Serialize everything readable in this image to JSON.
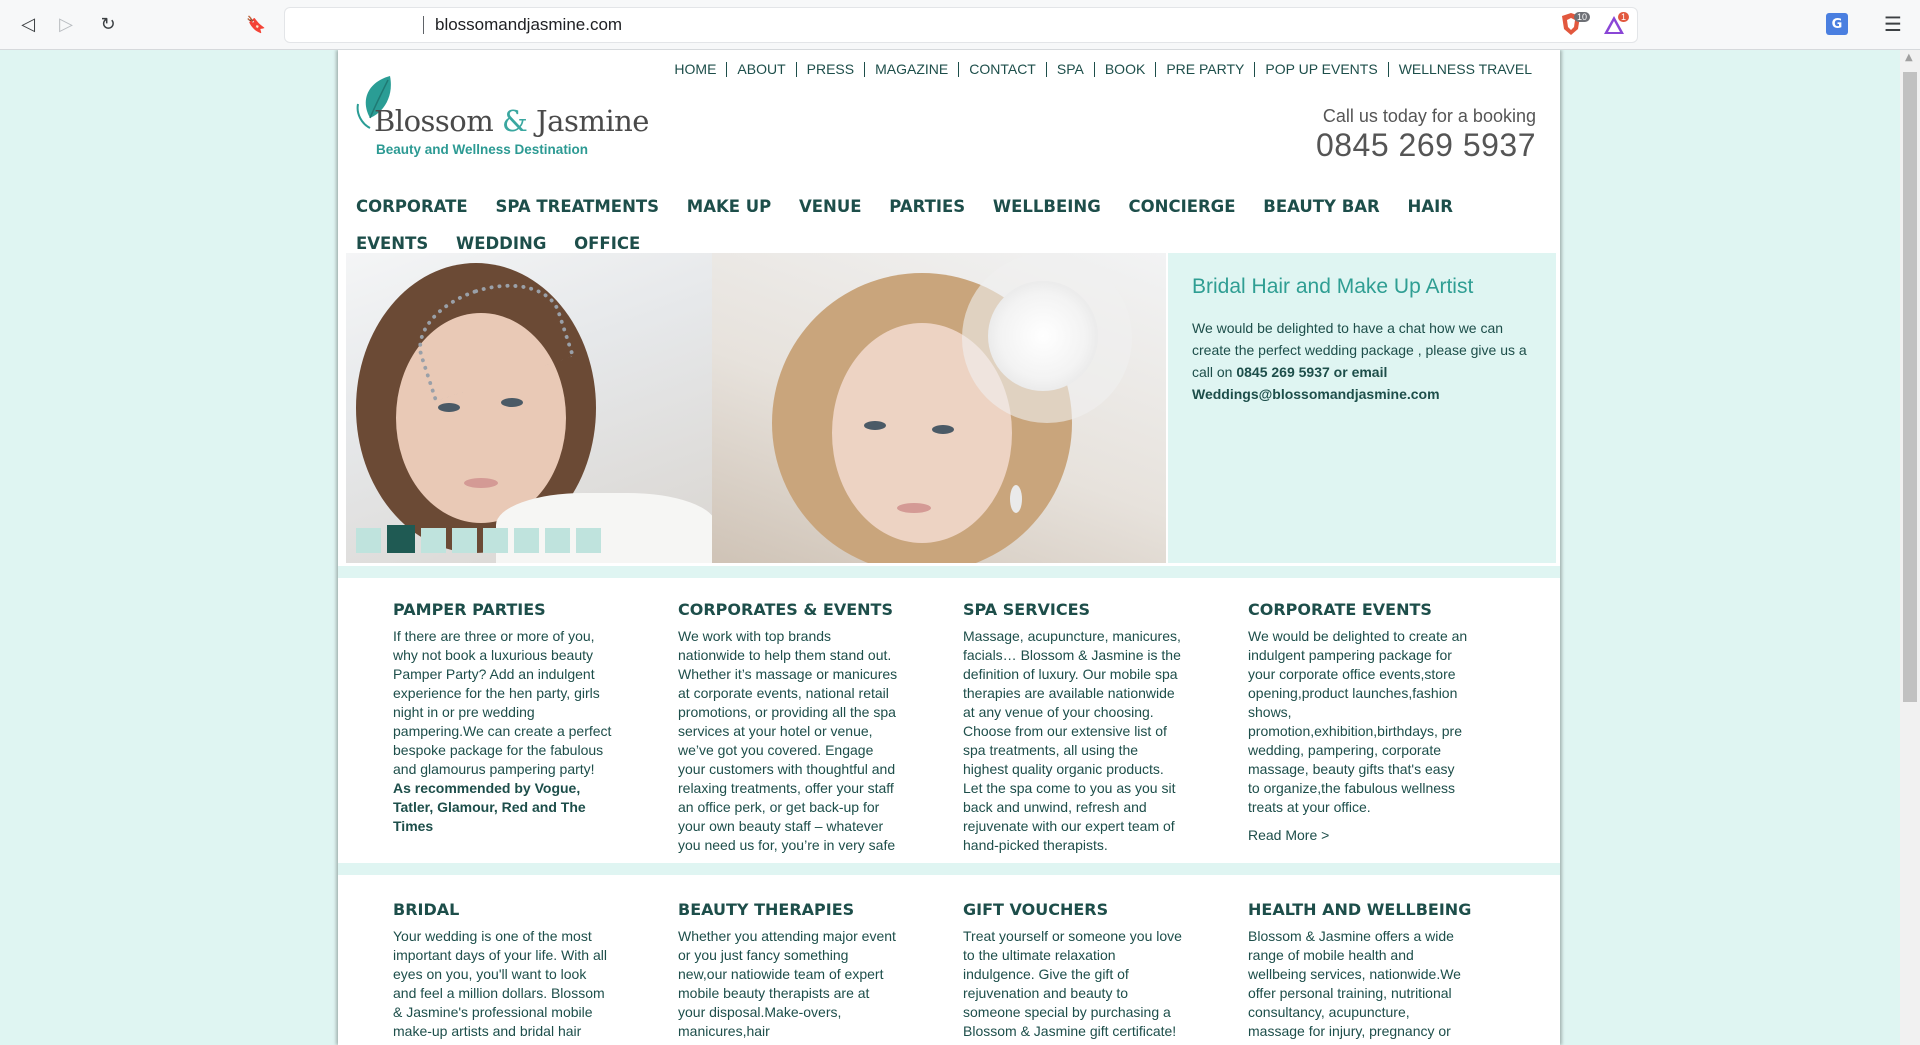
{
  "browser": {
    "url": "blossomandjasmine.com",
    "back_icon": "back-arrow-icon",
    "forward_icon": "forward-arrow-icon",
    "reload_icon": "reload-icon",
    "bookmark_icon": "bookmark-icon",
    "shield_badge": "10",
    "rewards_badge": "1",
    "back_glyph": "◁",
    "forward_glyph": "▷",
    "reload_glyph": "↻",
    "bookmark_glyph": "🔖",
    "menu_glyph": "☰",
    "translate_glyph": "G"
  },
  "topnav": [
    "HOME",
    "ABOUT",
    "PRESS",
    "MAGAZINE",
    "CONTACT",
    "SPA",
    "BOOK",
    "PRE PARTY",
    "POP UP EVENTS",
    "WELLNESS TRAVEL"
  ],
  "logo": {
    "title_left": "Blossom",
    "title_amp": "&",
    "title_right": "Jasmine",
    "subtitle": "Beauty and Wellness Destination"
  },
  "callus": {
    "line1": "Call us today for a booking",
    "phone": "0845 269 5937"
  },
  "mainnav": [
    "CORPORATE",
    "SPA TREATMENTS",
    "MAKE UP",
    "VENUE",
    "PARTIES",
    "WELLBEING",
    "CONCIERGE",
    "BEAUTY BAR",
    "HAIR",
    "EVENTS",
    "WEDDING",
    "OFFICE"
  ],
  "slider": {
    "slide_count": 8,
    "active_index": 1,
    "caption_title": "Bridal Hair and Make Up Artist",
    "caption_text": "We would be delighted to have a chat how we can create the perfect wedding package , please give us a call on ",
    "caption_bold": "0845 269 5937 or email Weddings@blossomandjasmine.com"
  },
  "sections_row1": [
    {
      "title": "PAMPER PARTIES",
      "text": "If there are three or more of you, why not book a luxurious beauty Pamper Party? Add an indulgent experience for the hen party, girls night in or pre wedding pampering.We can create a perfect bespoke package for the fabulous and glamourus pampering party! ",
      "bold": "As recommended by Vogue, Tatler, Glamour, Red and The Times",
      "more": ""
    },
    {
      "title": "CORPORATES & EVENTS",
      "text": "We work with top brands nationwide to help them stand out. Whether it’s massage or manicures at corporate events, national retail promotions, or providing all the spa services at your hotel or venue, we’ve got you covered. Engage your customers with thoughtful and relaxing treatments, offer your staff an office perk, or get back-up for your own beauty staff – whatever you need us for, you’re in very safe hands.",
      "bold": "",
      "more": ""
    },
    {
      "title": "SPA SERVICES",
      "text": "Massage, acupuncture, manicures, facials… Blossom & Jasmine is the definition of luxury. Our mobile spa therapies are available nationwide at any venue of your choosing. Choose from our extensive list of spa treatments, all using the highest quality organic products. Let the spa come to you as you sit back and unwind, refresh and rejuvenate with our expert team of hand-picked therapists.",
      "bold": "",
      "more": ""
    },
    {
      "title": "CORPORATE EVENTS",
      "text": "We would be delighted to create an indulgent pampering package for your corporate office events,store opening,product launches,fashion shows, promotion,exhibition,birthdays, pre wedding, pampering, corporate massage, beauty gifts that's easy to organize,the fabulous wellness treats at your office.",
      "bold": "",
      "more": "Read More >"
    }
  ],
  "sections_row2": [
    {
      "title": "BRIDAL",
      "text": "Your wedding is one of the most important days of your life. With all eyes on you, you'll want to look and feel a million dollars. Blossom & Jasmine's professional mobile make-up artists and bridal hair stylists are"
    },
    {
      "title": "BEAUTY THERAPIES",
      "text": "Whether you attending major event or you just fancy something new,our natiowide team of expert mobile beauty therapists are at your disposal.Make-overs, manicures,hair styling,tanning,make up"
    },
    {
      "title": "GIFT VOUCHERS",
      "text": "Treat yourself or someone you love to the ultimate relaxation indulgence. Give the gift of rejuvenation and beauty to someone special by purchasing a Blossom & Jasmine gift certificate!"
    },
    {
      "title": "HEALTH AND WELLBEING",
      "text": "Blossom & Jasmine offers a wide range of mobile health and wellbeing services, nationwide.We offer personal training, nutritional consultancy, acupuncture, massage for injury, pregnancy or stress"
    }
  ]
}
